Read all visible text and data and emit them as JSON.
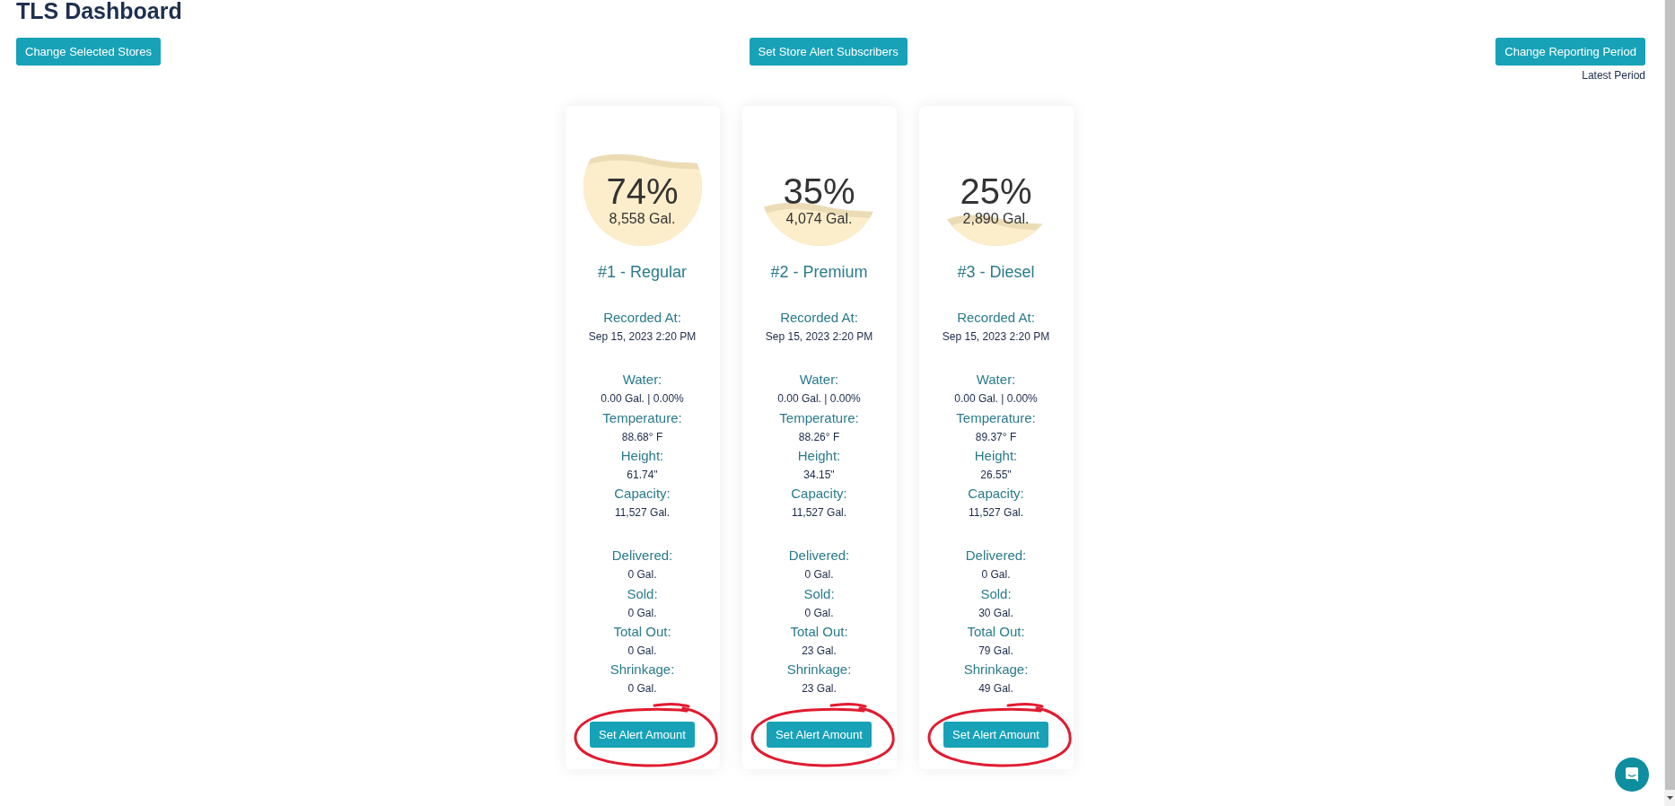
{
  "title": "TLS Dashboard",
  "header": {
    "left_button": "Change Selected Stores",
    "center_button": "Set Store Alert Subscribers",
    "right_button": "Change Reporting Period",
    "period_label": "Latest Period"
  },
  "tanks": [
    {
      "percent": "74%",
      "gallons": "8,558 Gal.",
      "level": 0.74,
      "name": "#1 - Regular",
      "sections": [
        {
          "fields": [
            {
              "label": "Recorded At:",
              "value": "Sep 15, 2023 2:20 PM"
            }
          ]
        },
        {
          "fields": [
            {
              "label": "Water:",
              "value": "0.00 Gal. | 0.00%"
            },
            {
              "label": "Temperature:",
              "value": "88.68° F"
            },
            {
              "label": "Height:",
              "value": "61.74\""
            },
            {
              "label": "Capacity:",
              "value": "11,527 Gal."
            }
          ]
        },
        {
          "fields": [
            {
              "label": "Delivered:",
              "value": "0 Gal."
            },
            {
              "label": "Sold:",
              "value": "0 Gal."
            },
            {
              "label": "Total Out:",
              "value": "0 Gal."
            },
            {
              "label": "Shrinkage:",
              "value": "0 Gal."
            }
          ]
        }
      ],
      "button": {
        "label": "Set Alert Amount",
        "circled": true
      }
    },
    {
      "percent": "35%",
      "gallons": "4,074 Gal.",
      "level": 0.35,
      "name": "#2 - Premium",
      "sections": [
        {
          "fields": [
            {
              "label": "Recorded At:",
              "value": "Sep 15, 2023 2:20 PM"
            }
          ]
        },
        {
          "fields": [
            {
              "label": "Water:",
              "value": "0.00 Gal. | 0.00%"
            },
            {
              "label": "Temperature:",
              "value": "88.26° F"
            },
            {
              "label": "Height:",
              "value": "34.15\""
            },
            {
              "label": "Capacity:",
              "value": "11,527 Gal."
            }
          ]
        },
        {
          "fields": [
            {
              "label": "Delivered:",
              "value": "0 Gal."
            },
            {
              "label": "Sold:",
              "value": "0 Gal."
            },
            {
              "label": "Total Out:",
              "value": "23 Gal."
            },
            {
              "label": "Shrinkage:",
              "value": "23 Gal."
            }
          ]
        }
      ],
      "button": {
        "label": "Set Alert Amount",
        "circled": true
      }
    },
    {
      "percent": "25%",
      "gallons": "2,890 Gal.",
      "level": 0.25,
      "name": "#3 - Diesel",
      "sections": [
        {
          "fields": [
            {
              "label": "Recorded At:",
              "value": "Sep 15, 2023 2:20 PM"
            }
          ]
        },
        {
          "fields": [
            {
              "label": "Water:",
              "value": "0.00 Gal. | 0.00%"
            },
            {
              "label": "Temperature:",
              "value": "89.37° F"
            },
            {
              "label": "Height:",
              "value": "26.55\""
            },
            {
              "label": "Capacity:",
              "value": "11,527 Gal."
            }
          ]
        },
        {
          "fields": [
            {
              "label": "Delivered:",
              "value": "0 Gal."
            },
            {
              "label": "Sold:",
              "value": "30 Gal."
            },
            {
              "label": "Total Out:",
              "value": "79 Gal."
            },
            {
              "label": "Shrinkage:",
              "value": "49 Gal."
            }
          ]
        }
      ],
      "button": {
        "label": "Set Alert Amount",
        "circled": true
      }
    }
  ]
}
